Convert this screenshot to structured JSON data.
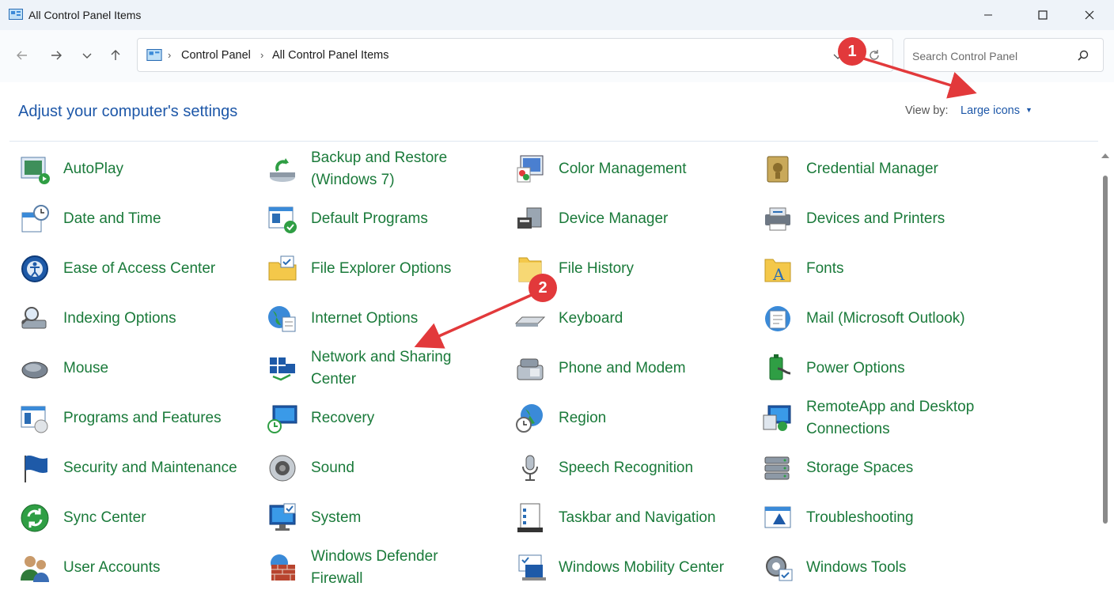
{
  "window": {
    "title": "All Control Panel Items"
  },
  "address": {
    "crumbs": [
      "Control Panel",
      "All Control Panel Items"
    ]
  },
  "search": {
    "placeholder": "Search Control Panel"
  },
  "content": {
    "heading": "Adjust your computer's settings",
    "view_by_label": "View by:",
    "view_by_value": "Large icons"
  },
  "callouts": [
    "1",
    "2"
  ],
  "colors": {
    "accent": "#1d57a8",
    "item_text": "#1a7a3a",
    "callout": "#e2393b"
  },
  "items": [
    {
      "label": "AutoPlay",
      "icon": "autoplay-icon"
    },
    {
      "label": "Backup and Restore\n(Windows 7)",
      "icon": "backup-icon"
    },
    {
      "label": "Color Management",
      "icon": "color-management-icon"
    },
    {
      "label": "Credential Manager",
      "icon": "credential-manager-icon"
    },
    {
      "label": "Date and Time",
      "icon": "date-time-icon"
    },
    {
      "label": "Default Programs",
      "icon": "default-programs-icon"
    },
    {
      "label": "Device Manager",
      "icon": "device-manager-icon"
    },
    {
      "label": "Devices and Printers",
      "icon": "devices-printers-icon"
    },
    {
      "label": "Ease of Access Center",
      "icon": "ease-of-access-icon"
    },
    {
      "label": "File Explorer Options",
      "icon": "file-explorer-options-icon"
    },
    {
      "label": "File History",
      "icon": "file-history-icon"
    },
    {
      "label": "Fonts",
      "icon": "fonts-icon"
    },
    {
      "label": "Indexing Options",
      "icon": "indexing-options-icon"
    },
    {
      "label": "Internet Options",
      "icon": "internet-options-icon"
    },
    {
      "label": "Keyboard",
      "icon": "keyboard-icon"
    },
    {
      "label": "Mail (Microsoft Outlook)",
      "icon": "mail-icon"
    },
    {
      "label": "Mouse",
      "icon": "mouse-icon"
    },
    {
      "label": "Network and Sharing\nCenter",
      "icon": "network-sharing-icon"
    },
    {
      "label": "Phone and Modem",
      "icon": "phone-modem-icon"
    },
    {
      "label": "Power Options",
      "icon": "power-options-icon"
    },
    {
      "label": "Programs and Features",
      "icon": "programs-features-icon"
    },
    {
      "label": "Recovery",
      "icon": "recovery-icon"
    },
    {
      "label": "Region",
      "icon": "region-icon"
    },
    {
      "label": "RemoteApp and Desktop\nConnections",
      "icon": "remoteapp-icon"
    },
    {
      "label": "Security and Maintenance",
      "icon": "security-maintenance-icon"
    },
    {
      "label": "Sound",
      "icon": "sound-icon"
    },
    {
      "label": "Speech Recognition",
      "icon": "speech-recognition-icon"
    },
    {
      "label": "Storage Spaces",
      "icon": "storage-spaces-icon"
    },
    {
      "label": "Sync Center",
      "icon": "sync-center-icon"
    },
    {
      "label": "System",
      "icon": "system-icon"
    },
    {
      "label": "Taskbar and Navigation",
      "icon": "taskbar-navigation-icon"
    },
    {
      "label": "Troubleshooting",
      "icon": "troubleshooting-icon"
    },
    {
      "label": "User Accounts",
      "icon": "user-accounts-icon"
    },
    {
      "label": "Windows Defender\nFirewall",
      "icon": "firewall-icon"
    },
    {
      "label": "Windows Mobility Center",
      "icon": "mobility-center-icon"
    },
    {
      "label": "Windows Tools",
      "icon": "windows-tools-icon"
    }
  ]
}
